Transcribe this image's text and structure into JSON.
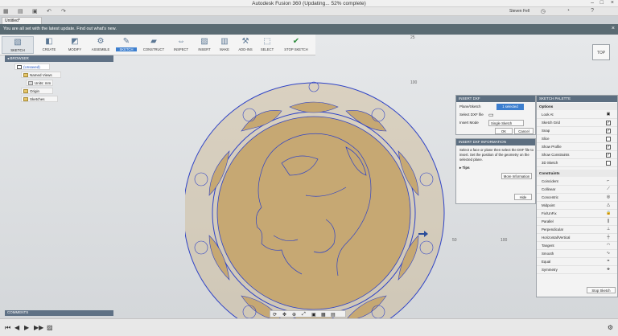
{
  "window": {
    "title": "Autodesk Fusion 360 (Updating... 52% complete)"
  },
  "quick_access": {
    "user": "Steven Fell"
  },
  "document": {
    "tab": "Untitled*"
  },
  "banner": {
    "message": "You are all set with the latest update. Find out what's new."
  },
  "toolbar": {
    "workspace": "SKETCH",
    "groups": [
      "CREATE",
      "MODIFY",
      "ASSEMBLE",
      "SKETCH",
      "CONSTRUCT",
      "INSPECT",
      "INSERT",
      "MAKE",
      "ADD-INS",
      "SELECT",
      "STOP SKETCH"
    ]
  },
  "browser": {
    "header": "BROWSER",
    "items": [
      "(Unsaved)",
      "Named Views",
      "Units: mm",
      "Origin",
      "Sketches"
    ]
  },
  "viewcube": {
    "label": "TOP"
  },
  "axis": {
    "v_top": "25",
    "v_mid": "100",
    "h_right": "50",
    "h_far": "100"
  },
  "insert_dxf": {
    "header": "INSERT DXF",
    "plane_label": "Plane/Sketch",
    "plane_value": "1 selected",
    "file_label": "Select DXF file",
    "units_label": "Insert Mode",
    "units_value": "Single Sketch",
    "ok": "OK",
    "cancel": "Cancel"
  },
  "info_panel": {
    "header": "INSERT DXF INFORMATION",
    "text": "Select a face or plane then select the DXF file to insert. Set the position of the geometry on the selected plane.",
    "tips": "Tips",
    "more_info": "More Information",
    "hide": "Hide"
  },
  "palette": {
    "header": "SKETCH PALETTE",
    "options_label": "Options",
    "options": [
      {
        "label": "Look At",
        "ctrl": "cam"
      },
      {
        "label": "Sketch Grid",
        "ctrl": "on"
      },
      {
        "label": "Snap",
        "ctrl": "on"
      },
      {
        "label": "Slice",
        "ctrl": "off"
      },
      {
        "label": "Show Profile",
        "ctrl": "on"
      },
      {
        "label": "Show Constraints",
        "ctrl": "on"
      },
      {
        "label": "3D Sketch",
        "ctrl": "off"
      }
    ],
    "constraints_label": "Constraints",
    "constraints": [
      "Coincident",
      "Collinear",
      "Concentric",
      "Midpoint",
      "Fix/UnFix",
      "Parallel",
      "Perpendicular",
      "Horizontal/Vertical",
      "Tangent",
      "Smooth",
      "Equal",
      "Symmetry"
    ],
    "stop": "Stop Sketch"
  },
  "comments": {
    "label": "COMMENTS"
  },
  "colors": {
    "accent": "#3d7fcf",
    "panel_header": "#5f7185",
    "sketch_line": "#2f43c6",
    "wood": "#c9ad79"
  }
}
